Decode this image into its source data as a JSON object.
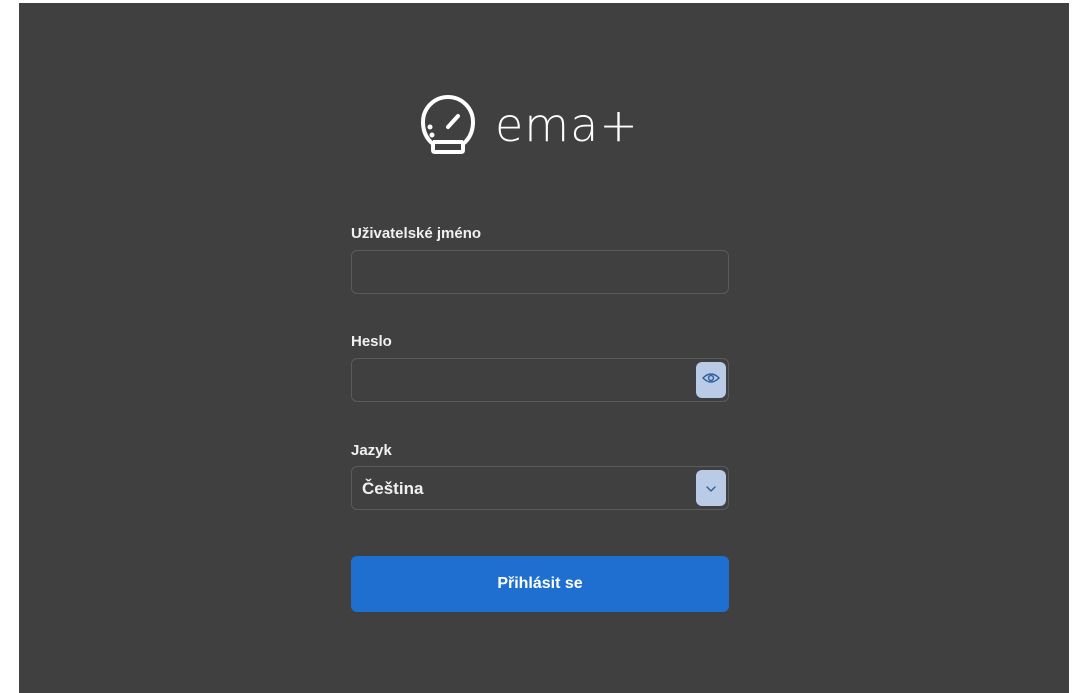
{
  "brand": {
    "name": "ema+"
  },
  "form": {
    "username": {
      "label": "Uživatelské jméno",
      "value": ""
    },
    "password": {
      "label": "Heslo",
      "value": ""
    },
    "language": {
      "label": "Jazyk",
      "selected": "Čeština"
    },
    "submit_label": "Přihlásit se"
  },
  "icons": {
    "logo": "speedometer-icon",
    "password_toggle": "eye-icon",
    "select_toggle": "chevron-down-icon"
  },
  "colors": {
    "background": "#404040",
    "primary_button": "#1f6fd1",
    "icon_button": "#b9cbe6"
  }
}
